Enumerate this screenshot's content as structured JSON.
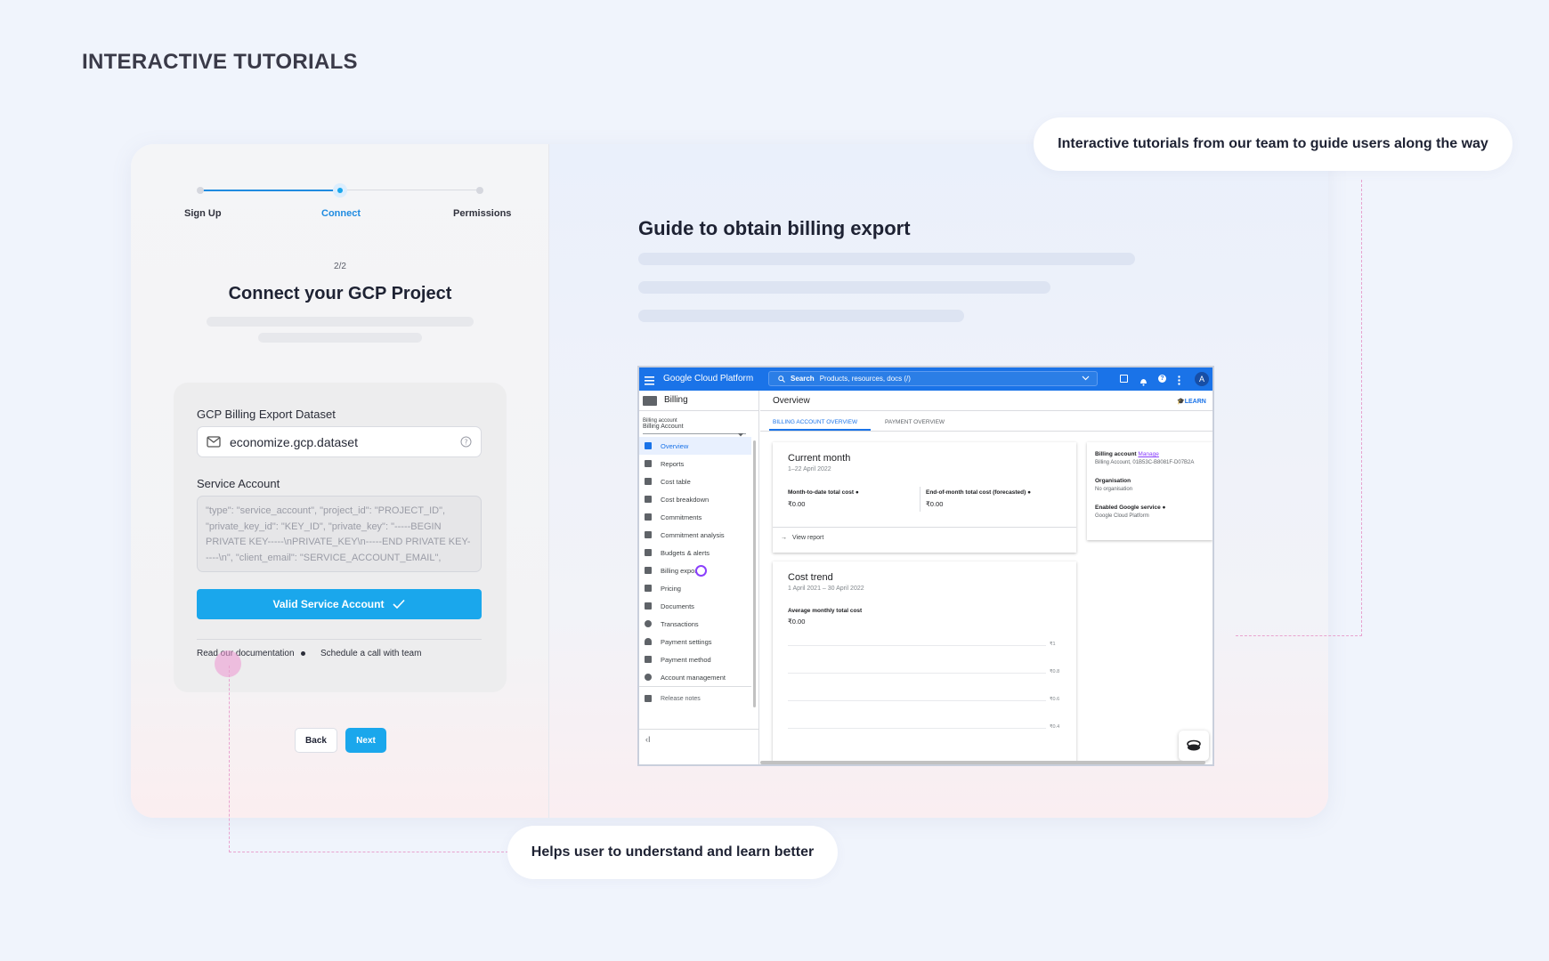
{
  "page": {
    "title": "INTERACTIVE TUTORIALS"
  },
  "stepper": {
    "steps": [
      {
        "label": "Sign Up"
      },
      {
        "label": "Connect"
      },
      {
        "label": "Permissions"
      }
    ]
  },
  "connect": {
    "step_counter": "2/2",
    "title": "Connect your GCP Project",
    "dataset_label": "GCP Billing Export Dataset",
    "dataset_value": "economize.gcp.dataset",
    "service_account_label": "Service Account",
    "service_account_placeholder": "\"type\": \"service_account\",  \"project_id\": \"PROJECT_ID\",  \"private_key_id\": \"KEY_ID\",  \"private_key\": \"-----BEGIN PRIVATE KEY-----\\nPRIVATE_KEY\\n-----END PRIVATE KEY-----\\n\",  \"client_email\": \"SERVICE_ACCOUNT_EMAIL\",",
    "valid_button": "Valid Service Account",
    "doc_link": "Read our documentation",
    "call_link": "Schedule a call with team",
    "back_button": "Back",
    "next_button": "Next"
  },
  "guide": {
    "title": "Guide to obtain billing export"
  },
  "gcp": {
    "brand": "Google Cloud Platform",
    "search_label": "Search",
    "search_placeholder": "Products, resources, docs (/)",
    "avatar_letter": "A",
    "section": "Billing",
    "billing_account_label": "Billing account",
    "billing_account_value": "Billing Account",
    "nav_items": [
      "Overview",
      "Reports",
      "Cost table",
      "Cost breakdown",
      "Commitments",
      "Commitment analysis",
      "Budgets & alerts",
      "Billing export",
      "Pricing",
      "Documents",
      "Transactions",
      "Payment settings",
      "Payment method",
      "Account management",
      "Release notes"
    ],
    "header_title": "Overview",
    "learn_label": "LEARN",
    "tabs": [
      "BILLING ACCOUNT OVERVIEW",
      "PAYMENT OVERVIEW"
    ],
    "current_month": {
      "title": "Current month",
      "range": "1–22 April 2022",
      "mtd_label": "Month-to-date total cost",
      "mtd_value": "₹0.00",
      "eom_label": "End-of-month total cost (forecasted)",
      "eom_value": "₹0.00",
      "view_report": "View report"
    },
    "cost_trend": {
      "title": "Cost trend",
      "range": "1 April 2021 – 30 April 2022",
      "avg_label": "Average monthly total cost",
      "avg_value": "₹0.00",
      "axis": [
        "₹1",
        "₹0.8",
        "₹0.6",
        "₹0.4"
      ]
    },
    "side_info": {
      "billing_account_label": "Billing account",
      "manage_link": "Manage",
      "billing_account_value": "Billing Account, 01B53C-B8081F-D07B2A",
      "org_label": "Organisation",
      "org_value": "No organisation",
      "service_label": "Enabled Google service",
      "service_value": "Google Cloud Platform"
    }
  },
  "callouts": {
    "top": "Interactive tutorials from our team to guide users along the way",
    "bottom": "Helps user to understand and learn better"
  },
  "colors": {
    "accent": "#1aa7ec",
    "gcp_blue": "#1a73e8",
    "dash_pink": "#e8a3cf"
  }
}
